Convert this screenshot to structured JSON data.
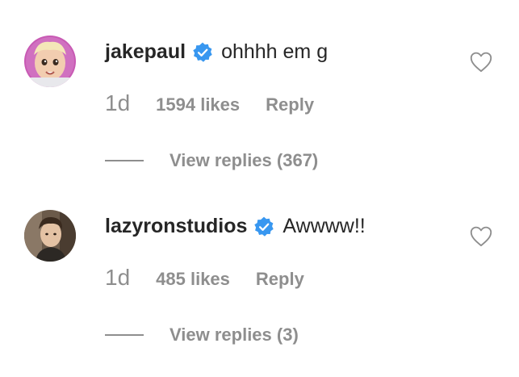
{
  "comments": [
    {
      "username": "jakepaul",
      "text": "ohhhh em g",
      "time": "1d",
      "likes": "1594 likes",
      "reply_label": "Reply",
      "view_replies": "View replies (367)",
      "avatar_icon": "memoji-avatar-icon",
      "verified_icon": "verified-badge-icon",
      "heart_icon": "heart-outline-icon"
    },
    {
      "username": "lazyronstudios",
      "text": "Awwww!!",
      "time": "1d",
      "likes": "485 likes",
      "reply_label": "Reply",
      "view_replies": "View replies (3)",
      "avatar_icon": "profile-photo-avatar-icon",
      "verified_icon": "verified-badge-icon",
      "heart_icon": "heart-outline-icon"
    }
  ],
  "colors": {
    "primary_text": "#262626",
    "secondary_text": "#8e8e8e",
    "verified_blue": "#3897f0",
    "background": "#ffffff"
  }
}
